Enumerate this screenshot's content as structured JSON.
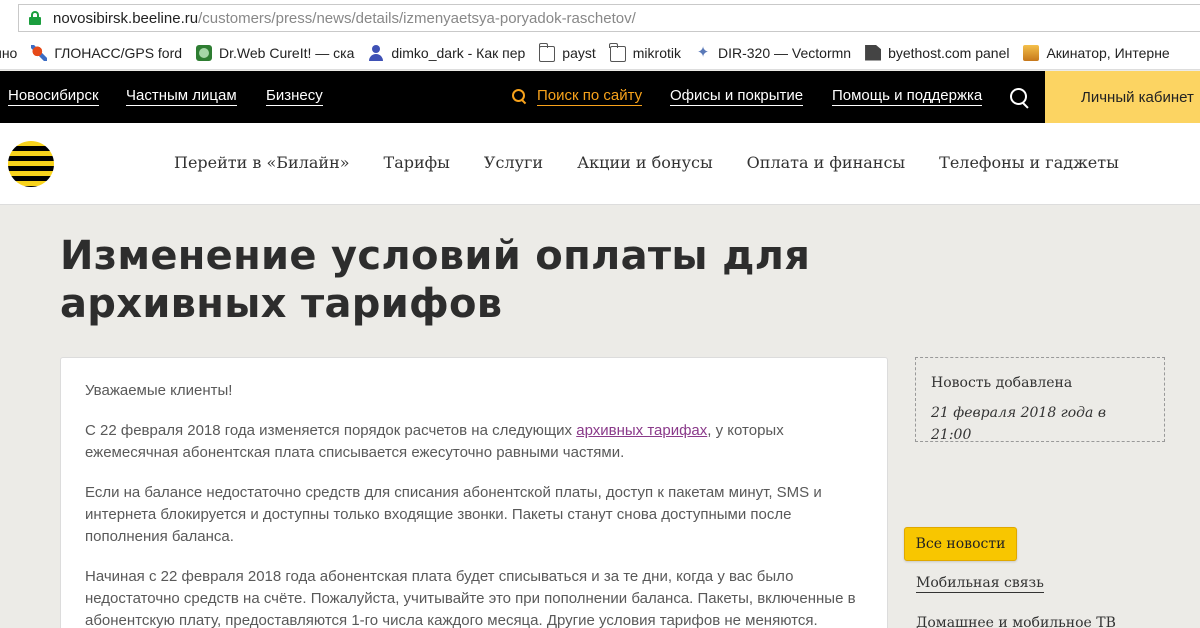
{
  "browser": {
    "url_domain": "novosibirsk.beeline.ru",
    "url_path": "/customers/press/news/details/izmenyaetsya-poryadok-raschetov/",
    "bookmarks": [
      {
        "label": "ино",
        "icon": "page-icon"
      },
      {
        "label": "ГЛОНАСС/GPS ford",
        "icon": "satellite-icon"
      },
      {
        "label": "Dr.Web CureIt! — ска",
        "icon": "drweb-icon"
      },
      {
        "label": "dimko_dark - Как пер",
        "icon": "user-icon"
      },
      {
        "label": "payst",
        "icon": "folder-icon"
      },
      {
        "label": "mikrotik",
        "icon": "folder-icon"
      },
      {
        "label": "DIR-320 — Vectormn",
        "icon": "star-icon"
      },
      {
        "label": "byethost.com panel",
        "icon": "document-icon"
      },
      {
        "label": "Акинатор, Интерне",
        "icon": "akinator-icon"
      }
    ]
  },
  "topnav": {
    "city": "Новосибирск",
    "private": "Частным лицам",
    "business": "Бизнесу",
    "search": "Поиск по сайту",
    "offices": "Офисы и покрытие",
    "help": "Помощь и поддержка",
    "cabinet": "Личный кабинет"
  },
  "mainmenu": {
    "items": [
      "Перейти в «Билайн»",
      "Тарифы",
      "Услуги",
      "Акции и бонусы",
      "Оплата и финансы",
      "Телефоны и гаджеты"
    ]
  },
  "page": {
    "title_line1": "Изменение условий оплаты для",
    "title_line2": "архивных тарифов"
  },
  "article": {
    "greeting": "Уважаемые клиенты!",
    "p1_before": "С 22 февраля 2018 года изменяется порядок расчетов на следующих ",
    "p1_link": "архивных тарифах",
    "p1_after": ", у которых ежемесячная абонентская плата списывается ежесуточно равными частями.",
    "p2": "Если на балансе недостаточно средств для списания абонентской платы, доступ к пакетам минут, SMS и интернета блокируется и доступны только входящие звонки. Пакеты станут снова доступными после пополнения баланса.",
    "p3": "Начиная с 22 февраля 2018 года абонентская плата будет списываться и за те дни, когда у вас было недостаточно средств на счёте. Пожалуйста, учитывайте это при пополнении баланса. Пакеты, включенные в абонентскую плату, предоставляются 1-го числа каждого месяца. Другие условия тарифов не меняются."
  },
  "sidebar": {
    "date_label": "Новость добавлена",
    "date_value": "21 февраля 2018 года в 21:00",
    "all_news": "Все новости",
    "links": [
      "Мобильная связь",
      "Домашнее и мобильное ТВ"
    ]
  },
  "colors": {
    "accent_yellow": "#f8c600",
    "cabinet_bg": "#fcd462",
    "search_orange": "#f7a21b",
    "link_purple": "#8a3a8a"
  }
}
